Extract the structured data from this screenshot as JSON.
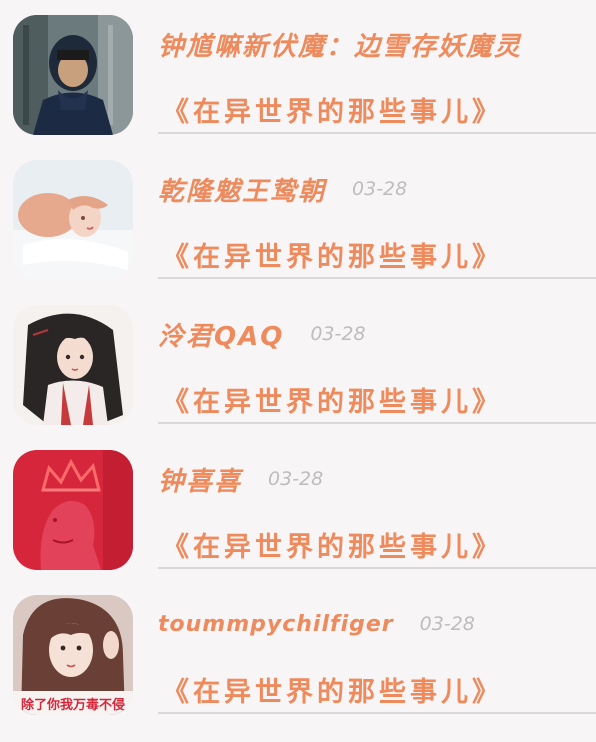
{
  "entries": [
    {
      "name": "钟馗嘛新伏魔：边雪存妖魔灵",
      "date": "",
      "book": "《在异世界的那些事儿》",
      "avatar_icon": "hooded-man-avatar"
    },
    {
      "name": "乾隆魃王鸷朝",
      "date": "03-28",
      "book": "《在异世界的那些事儿》",
      "avatar_icon": "woman-lying-avatar"
    },
    {
      "name": "泠君QAQ",
      "date": "03-28",
      "book": "《在异世界的那些事儿》",
      "avatar_icon": "anime-girl-avatar"
    },
    {
      "name": "钟喜喜",
      "date": "03-28",
      "book": "《在异世界的那些事儿》",
      "avatar_icon": "queen-crown-avatar"
    },
    {
      "name": "toummpychilfiger",
      "date": "03-28",
      "book": "《在异世界的那些事儿》",
      "avatar_icon": "girl-selfie-avatar",
      "avatar_caption": "除了你我万毒不侵"
    }
  ],
  "colors": {
    "accent": "#ee8a5c",
    "date": "#bdbdbd",
    "divider": "#d9d9d9",
    "background": "#f8f5f6"
  }
}
